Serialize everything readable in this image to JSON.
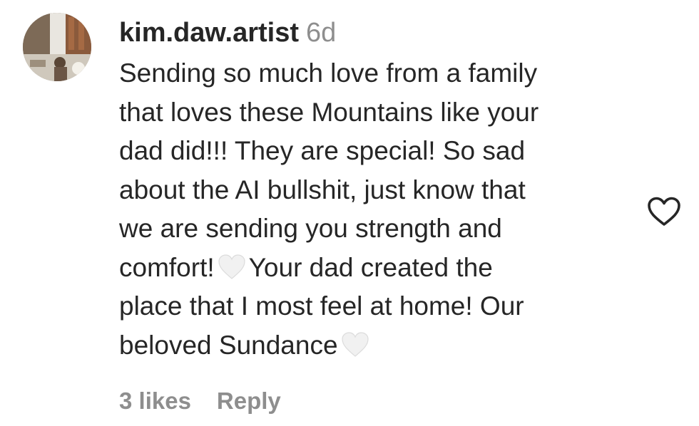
{
  "comment": {
    "username": "kim.daw.artist",
    "time_ago": "6d",
    "text_lines": [
      [
        "Sending so much love from a family"
      ],
      [
        "that loves these Mountains like your"
      ],
      [
        "dad did!!! They are special! So sad"
      ],
      [
        "about the AI bullshit, just know that"
      ],
      [
        "we are sending you strength and"
      ],
      [
        "comfort!",
        "Your dad created the"
      ],
      [
        "place that I most feel at home! Our"
      ],
      [
        "beloved Sundance"
      ]
    ],
    "emoji": "white-heart-emoji",
    "likes_label": "3 likes",
    "reply_label": "Reply",
    "like_icon": "heart-outline-icon"
  },
  "colors": {
    "text": "#262626",
    "secondary": "#8e8e8e",
    "emoji_heart": "#eeeeee"
  }
}
